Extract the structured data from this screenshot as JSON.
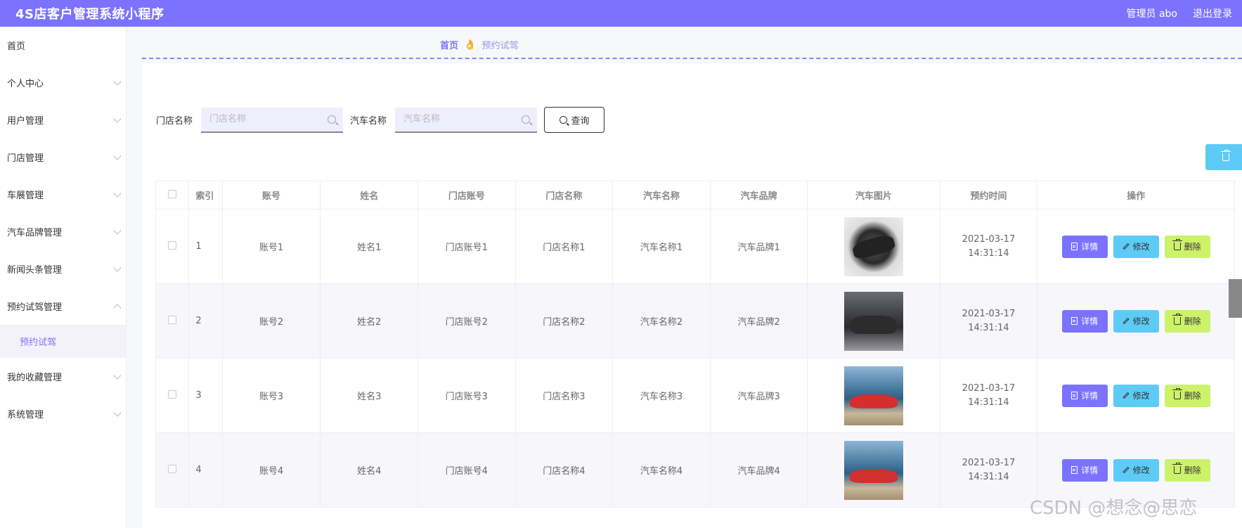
{
  "app": {
    "title": "4S店客户管理系统小程序"
  },
  "header": {
    "user": "管理员 abo",
    "logout": "退出登录"
  },
  "sidebar": {
    "items": [
      {
        "label": "首页",
        "chevron": false
      },
      {
        "label": "个人中心",
        "chevron": true
      },
      {
        "label": "用户管理",
        "chevron": true
      },
      {
        "label": "门店管理",
        "chevron": true
      },
      {
        "label": "车展管理",
        "chevron": true
      },
      {
        "label": "汽车品牌管理",
        "chevron": true
      },
      {
        "label": "新闻头条管理",
        "chevron": true
      },
      {
        "label": "预约试驾管理",
        "chevron": true,
        "expanded": true
      },
      {
        "label": "我的收藏管理",
        "chevron": true
      },
      {
        "label": "系统管理",
        "chevron": true
      }
    ],
    "sub_item": "预约试驾"
  },
  "breadcrumb": {
    "home": "首页",
    "separator": "👌",
    "current": "预约试驾"
  },
  "search": {
    "store_label": "门店名称",
    "store_placeholder": "门店名称",
    "car_label": "汽车名称",
    "car_placeholder": "汽车名称",
    "query_button": "查询"
  },
  "table": {
    "headers": [
      "",
      "索引",
      "账号",
      "姓名",
      "门店账号",
      "门店名称",
      "汽车名称",
      "汽车品牌",
      "汽车图片",
      "预约时间",
      "操作"
    ],
    "rows": [
      {
        "index": "1",
        "account": "账号1",
        "name": "姓名1",
        "store_account": "门店账号1",
        "store_name": "门店名称1",
        "car_name": "汽车名称1",
        "car_brand": "汽车品牌1",
        "image": "car1",
        "time": "2021-03-17 14:31:14"
      },
      {
        "index": "2",
        "account": "账号2",
        "name": "姓名2",
        "store_account": "门店账号2",
        "store_name": "门店名称2",
        "car_name": "汽车名称2",
        "car_brand": "汽车品牌2",
        "image": "car2",
        "time": "2021-03-17 14:31:14"
      },
      {
        "index": "3",
        "account": "账号3",
        "name": "姓名3",
        "store_account": "门店账号3",
        "store_name": "门店名称3",
        "car_name": "汽车名称3",
        "car_brand": "汽车品牌3",
        "image": "car3",
        "time": "2021-03-17 14:31:14"
      },
      {
        "index": "4",
        "account": "账号4",
        "name": "姓名4",
        "store_account": "门店账号4",
        "store_name": "门店名称4",
        "car_name": "汽车名称4",
        "car_brand": "汽车品牌4",
        "image": "car3",
        "time": "2021-03-17 14:31:14"
      }
    ],
    "actions": {
      "detail": "详情",
      "edit": "修改",
      "delete": "删除"
    }
  },
  "watermark": "CSDN @想念@思恋",
  "colors": {
    "primary": "#7b73ff",
    "info": "#5ecbf6",
    "success": "#ccf26a"
  }
}
